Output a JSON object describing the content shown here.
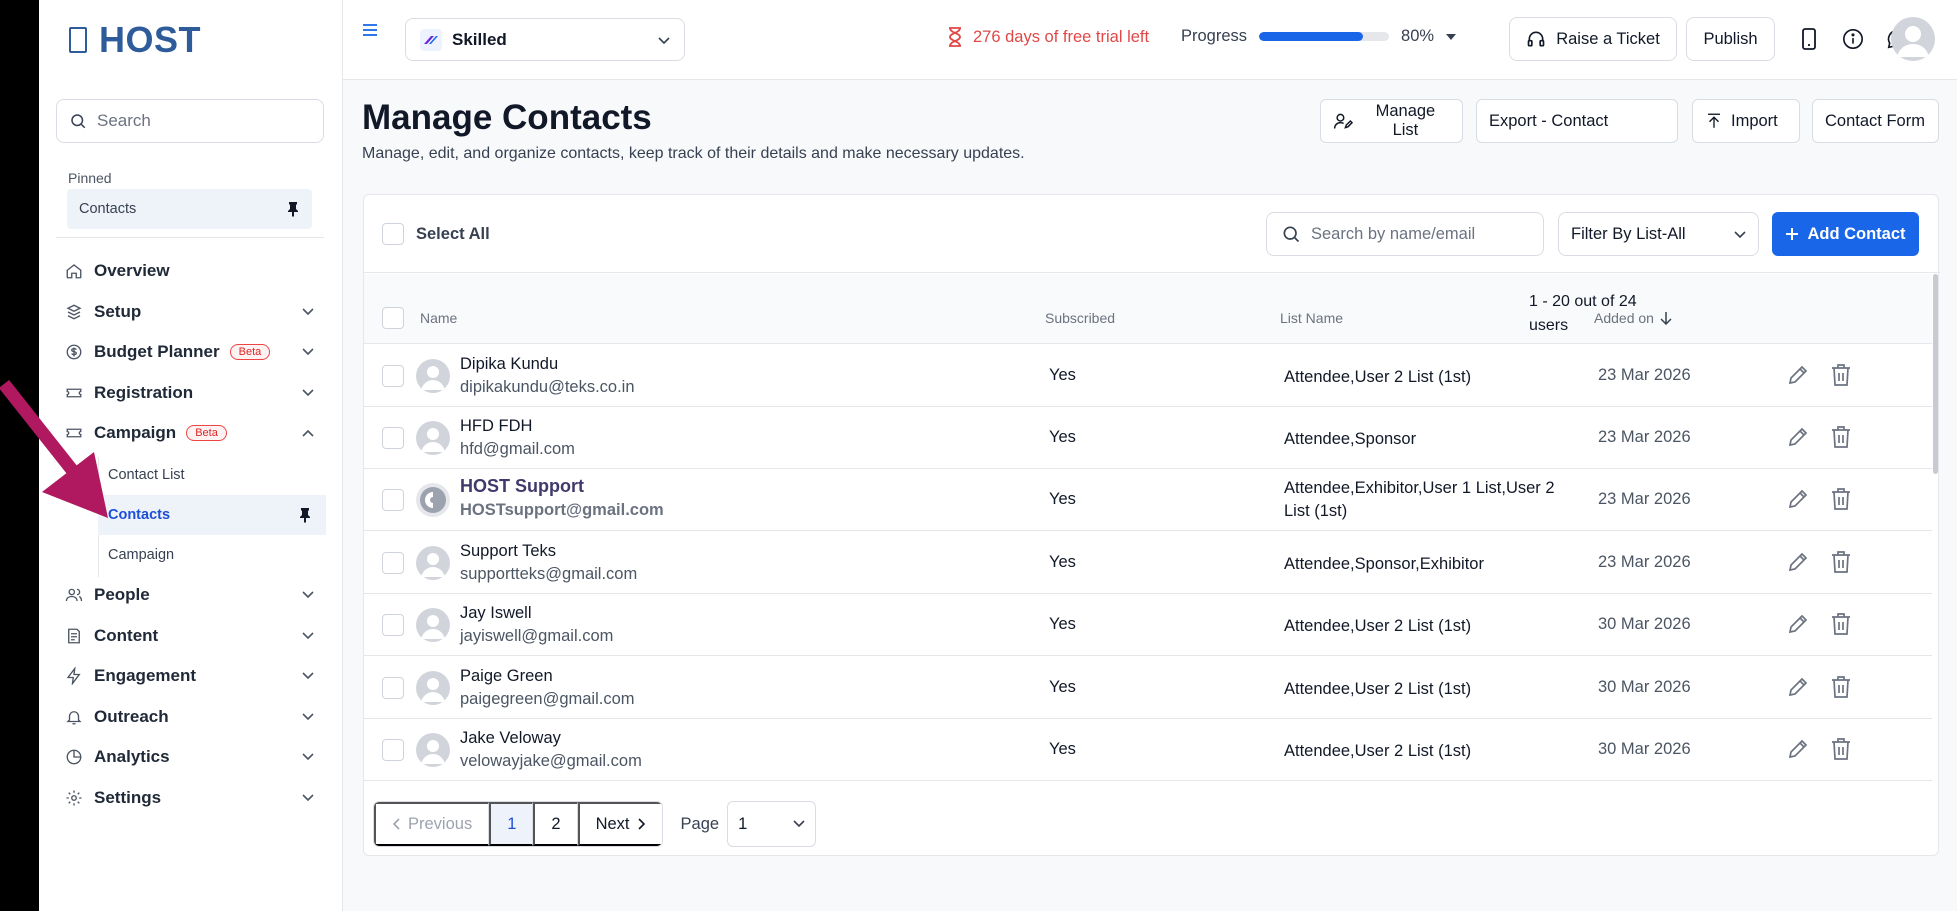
{
  "sidebar": {
    "logo_text": "HOST",
    "search_placeholder": "Search",
    "pinned_title": "Pinned",
    "pinned_item": "Contacts",
    "nav": {
      "overview": "Overview",
      "setup": "Setup",
      "budget": "Budget Planner",
      "budget_badge": "Beta",
      "registration": "Registration",
      "campaign": "Campaign",
      "campaign_badge": "Beta",
      "sub_contact_list": "Contact List",
      "sub_contacts": "Contacts",
      "sub_campaign": "Campaign",
      "people": "People",
      "content": "Content",
      "engagement": "Engagement",
      "outreach": "Outreach",
      "analytics": "Analytics",
      "settings": "Settings"
    }
  },
  "topbar": {
    "project": "Skilled",
    "trial": "276 days of free trial left",
    "progress_label": "Progress",
    "progress_value": 80,
    "progress_text": "80%",
    "raise_ticket": "Raise a Ticket",
    "publish": "Publish"
  },
  "main": {
    "title": "Manage Contacts",
    "subtitle": "Manage, edit, and organize contacts, keep track of their details and make necessary updates.",
    "buttons": {
      "manage_list": "Manage List",
      "export": "Export - Contact",
      "import": "Import",
      "contact_form": "Contact Form"
    },
    "select_all": "Select All",
    "search_placeholder": "Search by name/email",
    "filter": "Filter By List-All",
    "add_contact": "Add Contact",
    "columns": {
      "name": "Name",
      "subscribed": "Subscribed",
      "list_name": "List Name",
      "added_on": "Added on"
    },
    "count": "1 - 20 out of 24 users",
    "rows": [
      {
        "name": "Dipika Kundu",
        "email": "dipikakundu@teks.co.in",
        "subscribed": "Yes",
        "list": "Attendee,User 2 List (1st)",
        "date": "23 Mar 2026"
      },
      {
        "name": "HFD FDH",
        "email": "hfd@gmail.com",
        "subscribed": "Yes",
        "list": "Attendee,Sponsor",
        "date": "23 Mar 2026"
      },
      {
        "name": "HOST Support",
        "email": "HOSTsupport@gmail.com",
        "subscribed": "Yes",
        "list": "Attendee,Exhibitor,User 1 List,User 2 List (1st)",
        "date": "23 Mar 2026"
      },
      {
        "name": "Support Teks",
        "email": "supportteks@gmail.com",
        "subscribed": "Yes",
        "list": "Attendee,Sponsor,Exhibitor",
        "date": "23 Mar 2026"
      },
      {
        "name": "Jay Iswell",
        "email": "jayiswell@gmail.com",
        "subscribed": "Yes",
        "list": "Attendee,User 2 List (1st)",
        "date": "30 Mar 2026"
      },
      {
        "name": "Paige Green",
        "email": "paigegreen@gmail.com",
        "subscribed": "Yes",
        "list": "Attendee,User 2 List (1st)",
        "date": "30 Mar 2026"
      },
      {
        "name": "Jake Veloway",
        "email": "velowayjake@gmail.com",
        "subscribed": "Yes",
        "list": "Attendee,User 2 List (1st)",
        "date": "30 Mar 2026"
      }
    ],
    "pager": {
      "previous": "Previous",
      "p1": "1",
      "p2": "2",
      "next": "Next",
      "page_label": "Page",
      "page_value": "1"
    }
  },
  "colors": {
    "accent": "#1a66e8",
    "brand": "#2e5b9a",
    "trial_red": "#e04848",
    "annotation_arrow": "#b0195f"
  }
}
